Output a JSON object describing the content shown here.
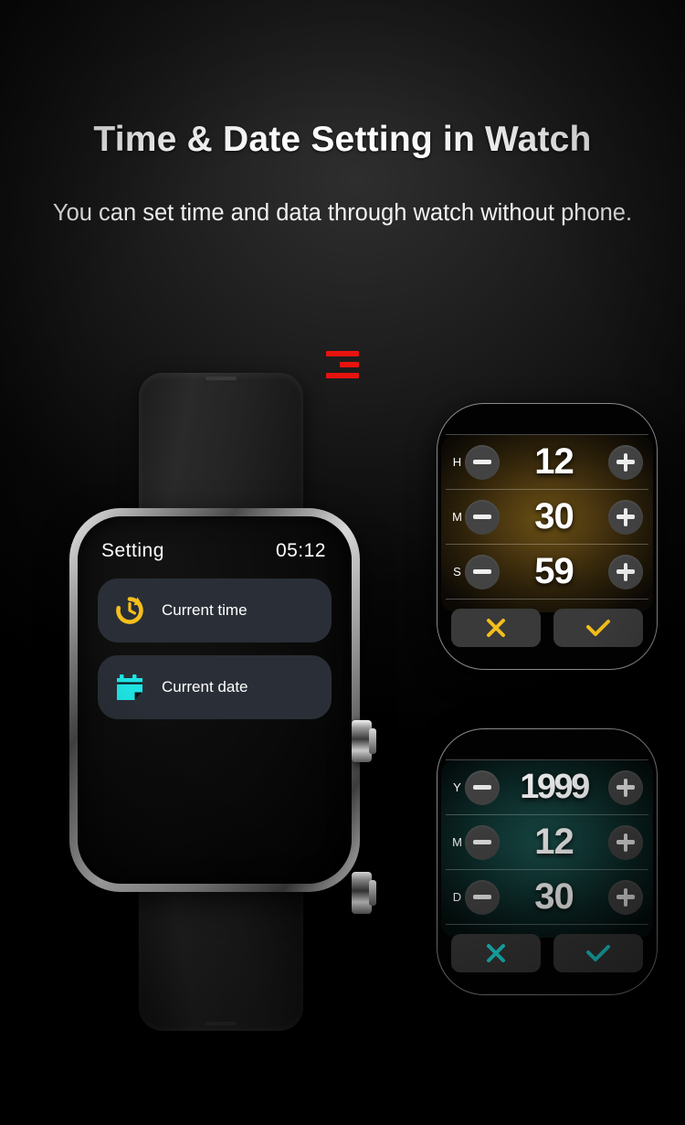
{
  "page": {
    "title": "Time & Date Setting in Watch",
    "subtitle": "You can set time and data through watch without phone."
  },
  "brand": {
    "logo_name": "red-bars-logo"
  },
  "colors": {
    "background": "#000000",
    "amber_accent": "#f5bf1b",
    "cyan_accent": "#1fe3e3",
    "logo_red": "#e8130f",
    "menu_row_bg": "#2a2f37"
  },
  "watch": {
    "screen": {
      "header_label": "Setting",
      "header_time": "05:12",
      "menu_items": [
        {
          "icon": "clock-restore-icon",
          "label": "Current time",
          "color": "#f5bf1b"
        },
        {
          "icon": "calendar-icon",
          "label": "Current date",
          "color": "#1fe3e3"
        }
      ]
    },
    "side_buttons": [
      "crown-button-top",
      "crown-button-bottom"
    ]
  },
  "time_panel": {
    "accent": "#f5bf1b",
    "rows": [
      {
        "unit": "H",
        "value": "12",
        "minus": "−",
        "plus": "+"
      },
      {
        "unit": "M",
        "value": "30",
        "minus": "−",
        "plus": "+"
      },
      {
        "unit": "S",
        "value": "59",
        "minus": "−",
        "plus": "+"
      }
    ],
    "cancel_icon": "close-icon",
    "confirm_icon": "check-icon"
  },
  "date_panel": {
    "accent": "#1fe3e3",
    "rows": [
      {
        "unit": "Y",
        "value": "1999",
        "minus": "−",
        "plus": "+"
      },
      {
        "unit": "M",
        "value": "12",
        "minus": "−",
        "plus": "+"
      },
      {
        "unit": "D",
        "value": "30",
        "minus": "−",
        "plus": "+"
      }
    ],
    "cancel_icon": "close-icon",
    "confirm_icon": "check-icon"
  }
}
